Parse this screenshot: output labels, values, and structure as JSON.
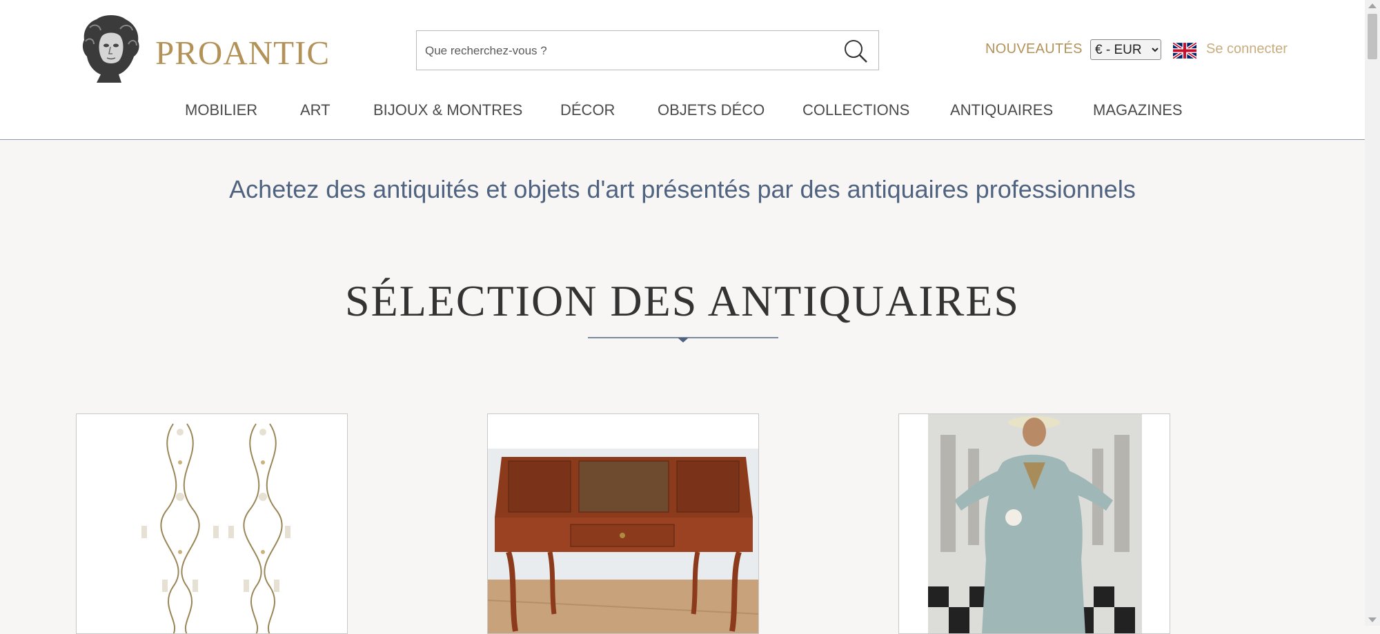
{
  "header": {
    "logo_text": "PROANTIC",
    "search": {
      "placeholder": "Que recherchez-vous ?"
    },
    "nouveautes_label": "NOUVEAUTÉS",
    "currency": {
      "selected": "€ - EUR"
    },
    "login_label": "Se connecter"
  },
  "nav": {
    "items": [
      {
        "label": "MOBILIER"
      },
      {
        "label": "ART"
      },
      {
        "label": "BIJOUX & MONTRES"
      },
      {
        "label": "DÉCOR"
      },
      {
        "label": "OBJETS DÉCO"
      },
      {
        "label": "COLLECTIONS"
      },
      {
        "label": "ANTIQUAIRES"
      },
      {
        "label": "MAGAZINES"
      }
    ]
  },
  "main": {
    "tagline": "Achetez des antiquités et objets d'art présentés par des antiquaires professionnels",
    "section_title": "SÉLECTION DES ANTIQUAIRES"
  },
  "colors": {
    "brand_gold": "#b39257",
    "accent_blue": "#4f6380",
    "background": "#f7f6f4"
  },
  "icons": [
    "logo-bust-icon",
    "search-icon",
    "uk-flag-icon"
  ]
}
